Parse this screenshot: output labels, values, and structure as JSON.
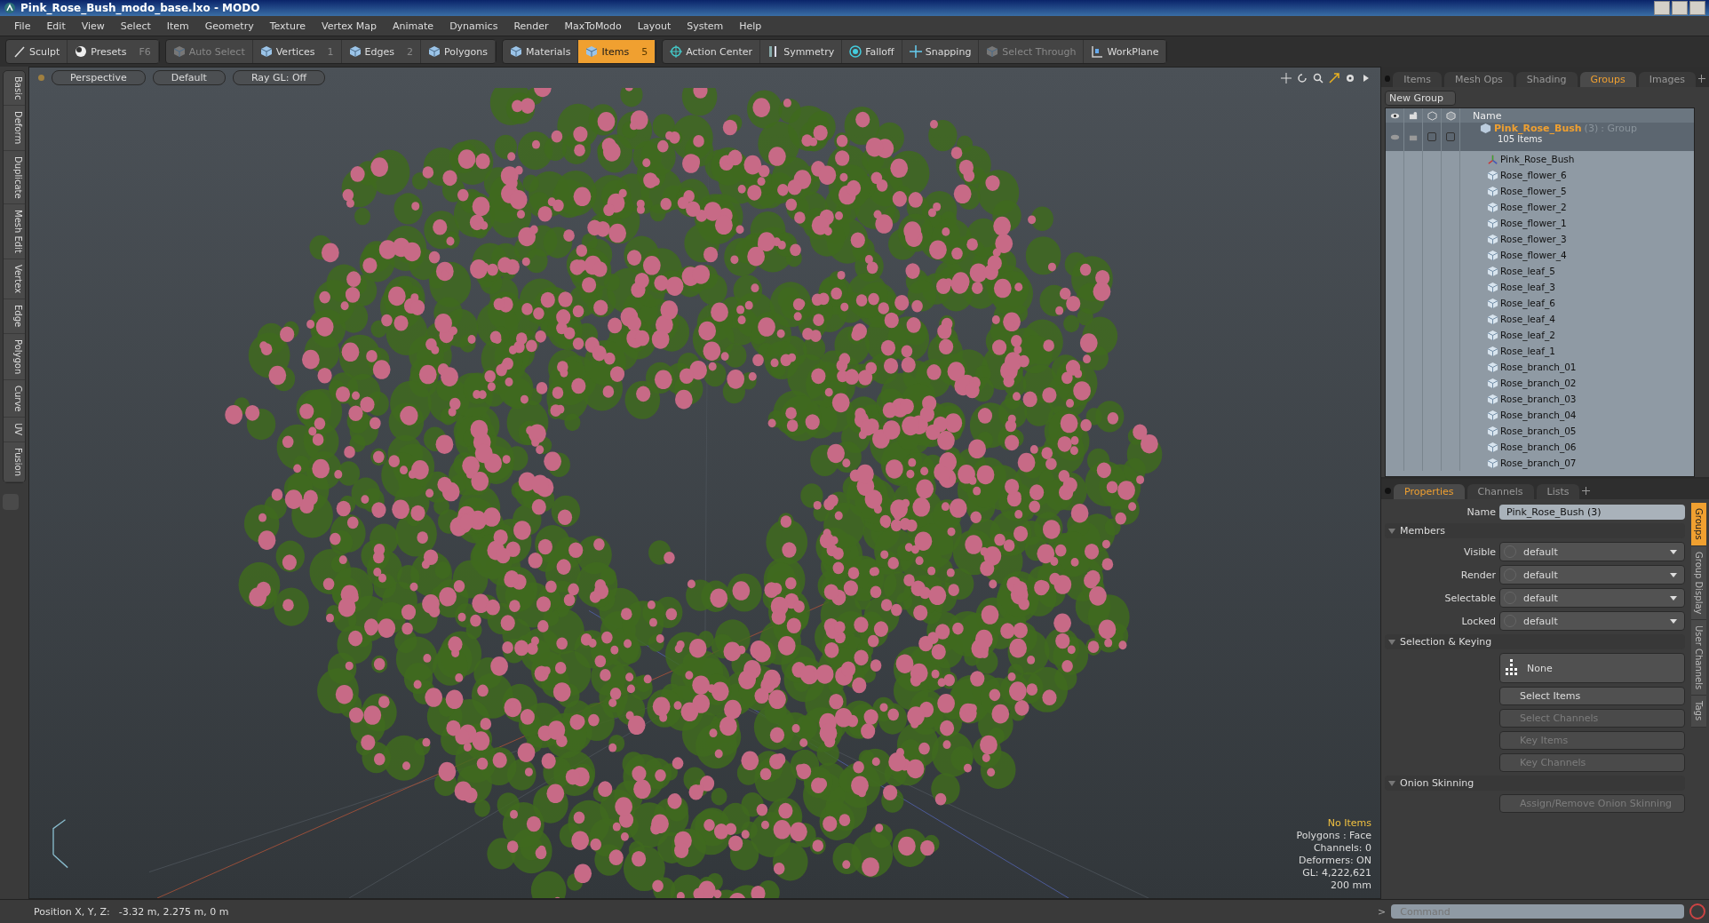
{
  "window": {
    "title": "Pink_Rose_Bush_modo_base.lxo - MODO"
  },
  "menu": [
    "File",
    "Edit",
    "View",
    "Select",
    "Item",
    "Geometry",
    "Texture",
    "Vertex Map",
    "Animate",
    "Dynamics",
    "Render",
    "MaxToModo",
    "Layout",
    "System",
    "Help"
  ],
  "toolbar": [
    [
      {
        "label": "Sculpt",
        "selected": false,
        "disabled": false
      },
      {
        "label": "Presets",
        "shortcut": "F6",
        "selected": false,
        "disabled": false
      }
    ],
    [
      {
        "label": "Auto Select",
        "selected": false,
        "disabled": true
      },
      {
        "label": "Vertices",
        "shortcut": "1",
        "selected": false,
        "disabled": false
      },
      {
        "label": "Edges",
        "shortcut": "2",
        "selected": false,
        "disabled": false
      },
      {
        "label": "Polygons",
        "selected": false,
        "disabled": false
      }
    ],
    [
      {
        "label": "Materials",
        "selected": false,
        "disabled": false
      },
      {
        "label": "Items",
        "shortcut": "5",
        "selected": true,
        "disabled": false
      }
    ],
    [
      {
        "label": "Action Center",
        "selected": false,
        "disabled": false
      },
      {
        "label": "Symmetry",
        "selected": false,
        "disabled": false
      },
      {
        "label": "Falloff",
        "selected": false,
        "disabled": false
      },
      {
        "label": "Snapping",
        "selected": false,
        "disabled": false
      },
      {
        "label": "Select Through",
        "selected": false,
        "disabled": true
      },
      {
        "label": "WorkPlane",
        "selected": false,
        "disabled": false
      }
    ]
  ],
  "left_tabs": [
    "Basic",
    "Deform",
    "Duplicate",
    "Mesh Edit",
    "Vertex",
    "Edge",
    "Polygon",
    "Curve",
    "UV",
    "Fusion"
  ],
  "viewport": {
    "buttons": [
      "Perspective",
      "Default",
      "Ray GL: Off"
    ],
    "info": [
      {
        "text": "No Items",
        "highlight": true
      },
      {
        "text": "Polygons : Face",
        "highlight": false
      },
      {
        "text": "Channels: 0",
        "highlight": false
      },
      {
        "text": "Deformers: ON",
        "highlight": false
      },
      {
        "text": "GL: 4,222,621",
        "highlight": false
      },
      {
        "text": "200 mm",
        "highlight": false
      }
    ]
  },
  "status_bar": {
    "label": "Position X, Y, Z:",
    "value": "-3.32 m, 2.275 m, 0 m"
  },
  "groups_panel": {
    "tabs": [
      {
        "label": "Items",
        "selected": false
      },
      {
        "label": "Mesh Ops",
        "selected": false
      },
      {
        "label": "Shading",
        "selected": false
      },
      {
        "label": "Groups",
        "selected": true
      },
      {
        "label": "Images",
        "selected": false
      }
    ],
    "new_group": "New Group",
    "name_header": "Name",
    "group": {
      "selectable_checked": false,
      "locked_checked": false,
      "name": "Pink_Rose_Bush",
      "count": "(3)",
      "type": ": Group",
      "subtitle": "105 Items",
      "children": [
        {
          "name": "Pink_Rose_Bush",
          "kind": "locator"
        },
        {
          "name": "Rose_flower_6",
          "kind": "mesh"
        },
        {
          "name": "Rose_flower_5",
          "kind": "mesh"
        },
        {
          "name": "Rose_flower_2",
          "kind": "mesh"
        },
        {
          "name": "Rose_flower_1",
          "kind": "mesh"
        },
        {
          "name": "Rose_flower_3",
          "kind": "mesh"
        },
        {
          "name": "Rose_flower_4",
          "kind": "mesh"
        },
        {
          "name": "Rose_leaf_5",
          "kind": "mesh"
        },
        {
          "name": "Rose_leaf_3",
          "kind": "mesh"
        },
        {
          "name": "Rose_leaf_6",
          "kind": "mesh"
        },
        {
          "name": "Rose_leaf_4",
          "kind": "mesh"
        },
        {
          "name": "Rose_leaf_2",
          "kind": "mesh"
        },
        {
          "name": "Rose_leaf_1",
          "kind": "mesh"
        },
        {
          "name": "Rose_branch_01",
          "kind": "mesh"
        },
        {
          "name": "Rose_branch_02",
          "kind": "mesh"
        },
        {
          "name": "Rose_branch_03",
          "kind": "mesh"
        },
        {
          "name": "Rose_branch_04",
          "kind": "mesh"
        },
        {
          "name": "Rose_branch_05",
          "kind": "mesh"
        },
        {
          "name": "Rose_branch_06",
          "kind": "mesh"
        },
        {
          "name": "Rose_branch_07",
          "kind": "mesh"
        }
      ]
    }
  },
  "properties_panel": {
    "tabs": [
      {
        "label": "Properties",
        "selected": true
      },
      {
        "label": "Channels",
        "selected": false
      },
      {
        "label": "Lists",
        "selected": false
      }
    ],
    "name_label": "Name",
    "name_value": "Pink_Rose_Bush (3)",
    "sections": [
      {
        "title": "Members",
        "fields": [
          {
            "label": "Visible",
            "value": "default"
          },
          {
            "label": "Render",
            "value": "default"
          },
          {
            "label": "Selectable",
            "value": "default"
          },
          {
            "label": "Locked",
            "value": "default"
          }
        ]
      },
      {
        "title": "Selection & Keying",
        "buttons": [
          {
            "label": "None",
            "kind": "mode",
            "disabled": false
          },
          {
            "label": "Select Items",
            "kind": "plain",
            "disabled": false
          },
          {
            "label": "Select Channels",
            "kind": "plain",
            "disabled": true
          },
          {
            "label": "Key Items",
            "kind": "plain",
            "disabled": true
          },
          {
            "label": "Key Channels",
            "kind": "plain",
            "disabled": true
          }
        ]
      },
      {
        "title": "Onion Skinning",
        "buttons": [
          {
            "label": "Assign/Remove Onion Skinning",
            "kind": "plain",
            "disabled": true
          }
        ]
      }
    ],
    "side_tabs": [
      {
        "label": "Groups",
        "selected": true
      },
      {
        "label": "Group Display",
        "selected": false
      },
      {
        "label": "User Channels",
        "selected": false
      },
      {
        "label": "Tags",
        "selected": false
      }
    ]
  },
  "command": {
    "prompt": ">",
    "placeholder": "Command"
  }
}
